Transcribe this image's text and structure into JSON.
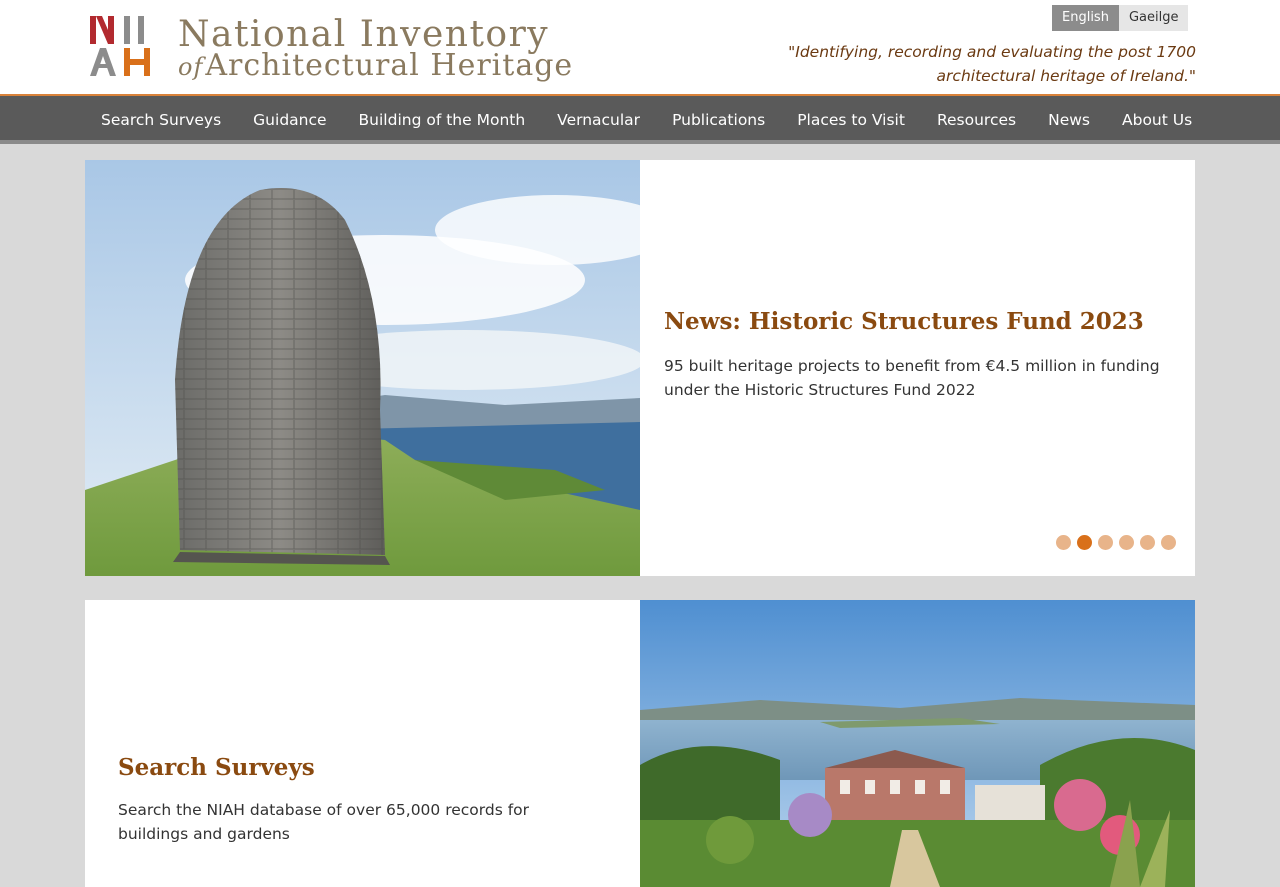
{
  "header": {
    "logo_line1": "National Inventory",
    "logo_line2_of": "of",
    "logo_line2": "Architectural Heritage",
    "tagline": "\"Identifying, recording and evaluating the post 1700 architectural heritage of Ireland.\"",
    "languages": [
      "English",
      "Gaeilge"
    ],
    "active_language": "English"
  },
  "nav": {
    "items": [
      "Search Surveys",
      "Guidance",
      "Building of the Month",
      "Vernacular",
      "Publications",
      "Places to Visit",
      "Resources",
      "News",
      "About Us"
    ]
  },
  "hero": {
    "title": "News: Historic Structures Fund 2023",
    "description": "95 built heritage projects to benefit from €4.5 million in funding under the Historic Structures Fund 2022",
    "slide_count": 6,
    "active_slide": 2,
    "image_alt": "stone beehive hut"
  },
  "search_card": {
    "title": "Search Surveys",
    "description": "Search the NIAH database of over 65,000 records for buildings and gardens",
    "image_alt": "country house and gardens by the bay"
  },
  "colors": {
    "accent": "#d9701a",
    "heading": "#8a4a10",
    "nav_bg": "#5a5a5a",
    "logo_red": "#b22a2f",
    "logo_orange": "#d9701a",
    "logo_gray": "#8c8c8c"
  }
}
